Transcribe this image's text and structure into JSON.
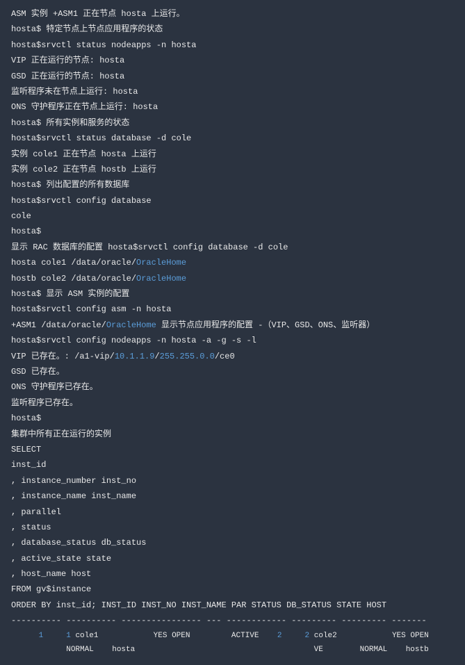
{
  "lines": [
    {
      "segments": [
        {
          "cls": "white",
          "text": "ASM 实例 "
        },
        {
          "cls": "white",
          "text": "+ASM1"
        },
        {
          "cls": "white",
          "text": " 正在节点 hosta 上运行。"
        }
      ]
    },
    {
      "segments": [
        {
          "cls": "white",
          "text": "hosta$ 特定节点上节点应用程序的状态"
        }
      ]
    },
    {
      "segments": [
        {
          "cls": "white",
          "text": "hosta$srvctl status nodeapps -n hosta"
        }
      ]
    },
    {
      "segments": [
        {
          "cls": "white",
          "text": "VIP 正在运行的节点: hosta"
        }
      ]
    },
    {
      "segments": [
        {
          "cls": "white",
          "text": "GSD 正在运行的节点: hosta"
        }
      ]
    },
    {
      "segments": [
        {
          "cls": "white",
          "text": "监听程序未在节点上运行: hosta"
        }
      ]
    },
    {
      "segments": [
        {
          "cls": "white",
          "text": "ONS 守护程序正在节点上运行: hosta"
        }
      ]
    },
    {
      "segments": [
        {
          "cls": "white",
          "text": "hosta$ 所有实例和服务的状态"
        }
      ]
    },
    {
      "segments": [
        {
          "cls": "white",
          "text": "hosta$srvctl status database -d cole"
        }
      ]
    },
    {
      "segments": [
        {
          "cls": "white",
          "text": "实例 cole1 正在节点 hosta 上运行"
        }
      ]
    },
    {
      "segments": [
        {
          "cls": "white",
          "text": "实例 cole2 正在节点 hostb 上运行"
        }
      ]
    },
    {
      "segments": [
        {
          "cls": "white",
          "text": "hosta$ 列出配置的所有数据库"
        }
      ]
    },
    {
      "segments": [
        {
          "cls": "white",
          "text": "hosta$srvctl config database"
        }
      ]
    },
    {
      "segments": [
        {
          "cls": "white",
          "text": "cole"
        }
      ]
    },
    {
      "segments": [
        {
          "cls": "white",
          "text": "hosta$"
        }
      ]
    },
    {
      "segments": [
        {
          "cls": "white",
          "text": "显示 RAC 数据库的配置 hosta$srvctl config database -d cole"
        }
      ]
    },
    {
      "segments": [
        {
          "cls": "white",
          "text": "hosta cole1 /data/oracle/"
        },
        {
          "cls": "link",
          "text": "OracleHome"
        }
      ]
    },
    {
      "segments": [
        {
          "cls": "white",
          "text": "hostb cole2 /data/oracle/"
        },
        {
          "cls": "link",
          "text": "OracleHome"
        }
      ]
    },
    {
      "segments": [
        {
          "cls": "white",
          "text": "hosta$ 显示 ASM 实例的配置"
        }
      ]
    },
    {
      "segments": [
        {
          "cls": "white",
          "text": "hosta$srvctl config asm -n hosta"
        }
      ]
    },
    {
      "segments": [
        {
          "cls": "white",
          "text": "+ASM1 /data/oracle/"
        },
        {
          "cls": "link",
          "text": "OracleHome"
        },
        {
          "cls": "white",
          "text": " 显示节点应用程序的配置 -（VIP、GSD、ONS、监听器）"
        }
      ]
    },
    {
      "segments": [
        {
          "cls": "white",
          "text": "hosta$srvctl config nodeapps -n hosta -a -g -s -l"
        }
      ]
    },
    {
      "segments": [
        {
          "cls": "white",
          "text": "VIP 已存在。: /a1-vip/"
        },
        {
          "cls": "link",
          "text": "10.1.1.9"
        },
        {
          "cls": "white",
          "text": "/"
        },
        {
          "cls": "link",
          "text": "255.255.0.0"
        },
        {
          "cls": "white",
          "text": "/ce0"
        }
      ]
    },
    {
      "segments": [
        {
          "cls": "white",
          "text": "GSD 已存在。"
        }
      ]
    },
    {
      "segments": [
        {
          "cls": "white",
          "text": "ONS 守护程序已存在。"
        }
      ]
    },
    {
      "segments": [
        {
          "cls": "white",
          "text": "监听程序已存在。"
        }
      ]
    },
    {
      "segments": [
        {
          "cls": "white",
          "text": "hosta$"
        }
      ]
    },
    {
      "segments": [
        {
          "cls": "white",
          "text": "集群中所有正在运行的实例"
        }
      ]
    },
    {
      "segments": [
        {
          "cls": "white",
          "text": "SELECT"
        }
      ]
    },
    {
      "segments": [
        {
          "cls": "white",
          "text": "inst_id"
        }
      ]
    },
    {
      "segments": [
        {
          "cls": "white",
          "text": ", instance_number inst_no"
        }
      ]
    },
    {
      "segments": [
        {
          "cls": "white",
          "text": ", instance_name inst_name"
        }
      ]
    },
    {
      "segments": [
        {
          "cls": "white",
          "text": ", parallel"
        }
      ]
    },
    {
      "segments": [
        {
          "cls": "white",
          "text": ", status"
        }
      ]
    },
    {
      "segments": [
        {
          "cls": "white",
          "text": ", database_status db_status"
        }
      ]
    },
    {
      "segments": [
        {
          "cls": "white",
          "text": ", active_state state"
        }
      ]
    },
    {
      "segments": [
        {
          "cls": "white",
          "text": ", host_name host"
        }
      ]
    },
    {
      "segments": [
        {
          "cls": "white",
          "text": "FROM gv$instance"
        }
      ]
    },
    {
      "segments": [
        {
          "cls": "white",
          "text": "ORDER BY inst_id;   INST_ID    INST_NO INST_NAME        PAR STATUS       DB_STATUS STATE     HOST"
        }
      ]
    },
    {
      "segments": [
        {
          "cls": "white",
          "text": "---------- ---------- ---------------- --- ------------ --------- --------- -------"
        }
      ]
    }
  ],
  "tableRow": {
    "prefix1": "      ",
    "n1": "1",
    "mid1": "     ",
    "n2": "1",
    "rest1": " cole1            YES OPEN         ACTIVE    ",
    "n3": "2",
    "mid2": "     ",
    "n4": "2",
    "rest2": " cole2            YES OPEN         ACTI"
  },
  "tableRow2": "            NORMAL    hosta                                       VE        NORMAL    hostb"
}
